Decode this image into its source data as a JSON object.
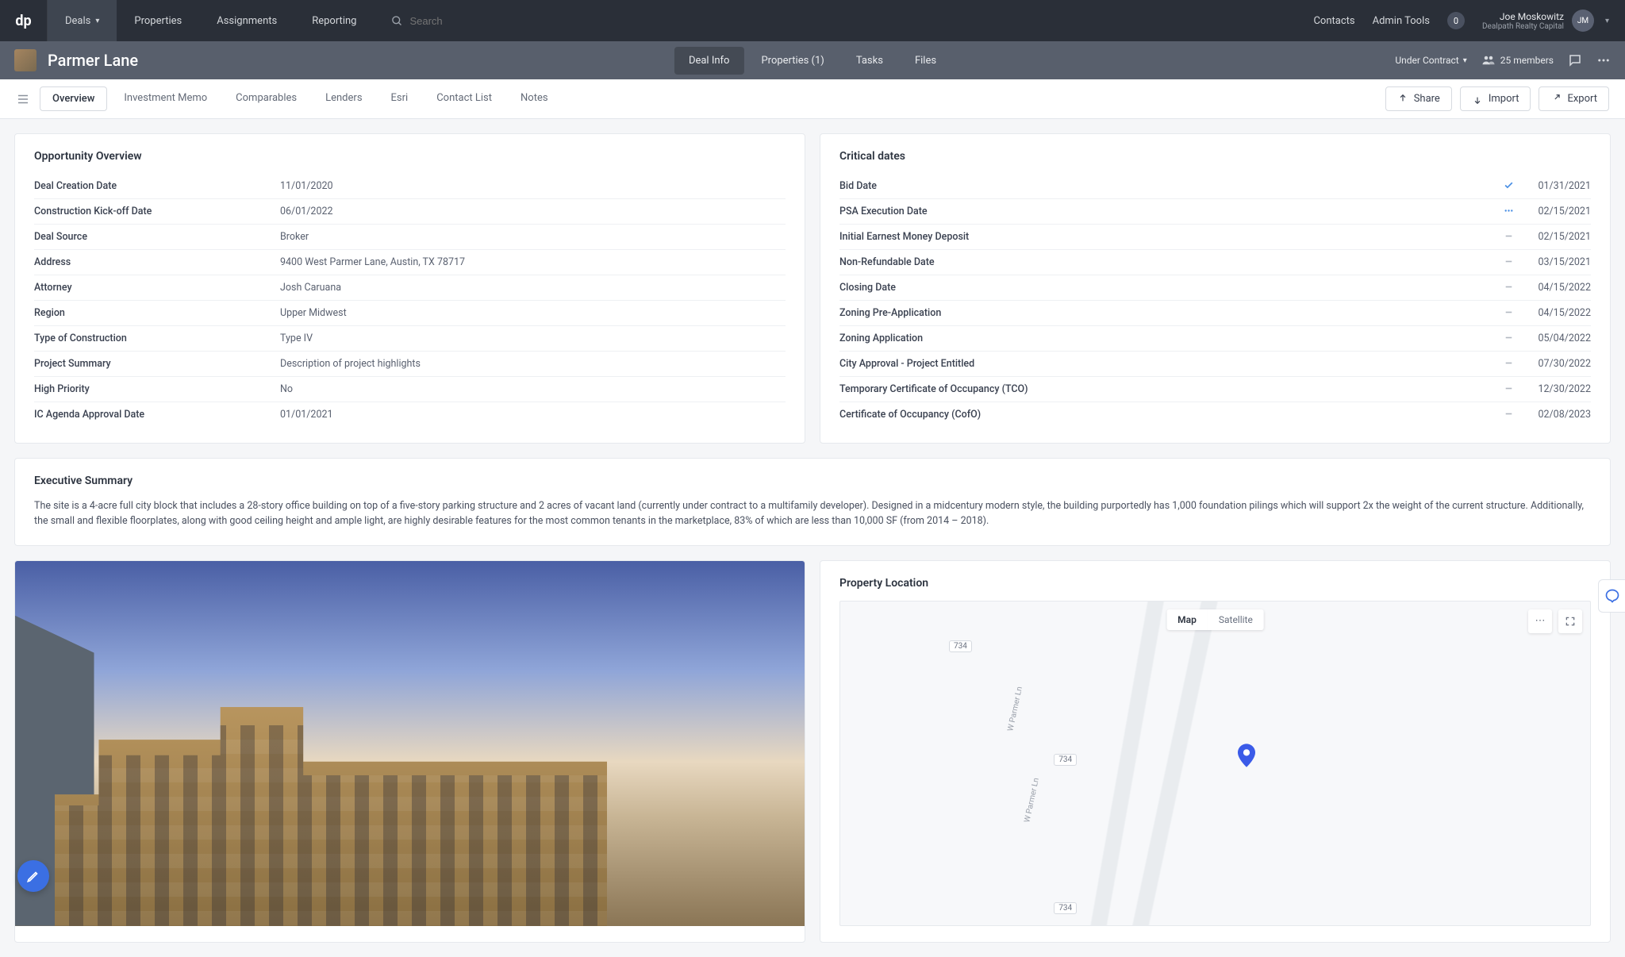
{
  "topnav": {
    "logo": "dp",
    "items": [
      "Deals",
      "Properties",
      "Assignments",
      "Reporting"
    ],
    "active_index": 0,
    "search_placeholder": "Search",
    "contacts": "Contacts",
    "admin_tools": "Admin Tools",
    "notif_count": "0",
    "user_name": "Joe Moskowitz",
    "user_org": "Dealpath Realty Capital",
    "user_initials": "JM"
  },
  "dealhead": {
    "title": "Parmer Lane",
    "tabs": [
      "Deal Info",
      "Properties (1)",
      "Tasks",
      "Files"
    ],
    "active_tab": 0,
    "status": "Under Contract",
    "members": "25 members"
  },
  "subtabs": {
    "items": [
      "Overview",
      "Investment Memo",
      "Comparables",
      "Lenders",
      "Esri",
      "Contact List",
      "Notes"
    ],
    "active_index": 0,
    "actions": {
      "share": "Share",
      "import": "Import",
      "export": "Export"
    }
  },
  "opportunity": {
    "title": "Opportunity Overview",
    "rows": [
      {
        "label": "Deal Creation Date",
        "value": "11/01/2020"
      },
      {
        "label": "Construction Kick-off Date",
        "value": "06/01/2022"
      },
      {
        "label": "Deal Source",
        "value": "Broker"
      },
      {
        "label": "Address",
        "value": "9400 West Parmer Lane, Austin, TX 78717"
      },
      {
        "label": "Attorney",
        "value": "Josh Caruana"
      },
      {
        "label": "Region",
        "value": "Upper Midwest"
      },
      {
        "label": "Type of Construction",
        "value": "Type IV"
      },
      {
        "label": "Project Summary",
        "value": "Description of project highlights"
      },
      {
        "label": "High Priority",
        "value": "No"
      },
      {
        "label": "IC Agenda Approval Date",
        "value": "01/01/2021"
      }
    ]
  },
  "critical": {
    "title": "Critical dates",
    "rows": [
      {
        "label": "Bid Date",
        "status": "check",
        "date": "01/31/2021"
      },
      {
        "label": "PSA Execution Date",
        "status": "progress",
        "date": "02/15/2021"
      },
      {
        "label": "Initial Earnest Money Deposit",
        "status": "dash",
        "date": "02/15/2021"
      },
      {
        "label": "Non-Refundable Date",
        "status": "dash",
        "date": "03/15/2021"
      },
      {
        "label": "Closing Date",
        "status": "dash",
        "date": "04/15/2022"
      },
      {
        "label": "Zoning Pre-Application",
        "status": "dash",
        "date": "04/15/2022"
      },
      {
        "label": "Zoning Application",
        "status": "dash",
        "date": "05/04/2022"
      },
      {
        "label": "City Approval - Project Entitled",
        "status": "dash",
        "date": "07/30/2022"
      },
      {
        "label": "Temporary Certificate of Occupancy (TCO)",
        "status": "dash",
        "date": "12/30/2022"
      },
      {
        "label": "Certificate of Occupancy (CofO)",
        "status": "dash",
        "date": "02/08/2023"
      }
    ]
  },
  "executive": {
    "title": "Executive Summary",
    "text": "The site is a 4-acre full city block that includes a 28-story office building on top of a five-story parking structure and 2 acres of vacant land (currently under contract to a multifamily developer). Designed in a midcentury modern style, the building purportedly has 1,000 foundation pilings which will support 2x the weight of the current structure. Additionally, the small and flexible floorplates, along with good ceiling height and ample light, are highly desirable features for the most common tenants in the marketplace, 83% of which are less than 10,000 SF (from 2014 – 2018)."
  },
  "map": {
    "title": "Property Location",
    "mode_map": "Map",
    "mode_sat": "Satellite",
    "road1": "W Parmer Ln",
    "road2": "W Parmer Ln",
    "route": "734"
  }
}
